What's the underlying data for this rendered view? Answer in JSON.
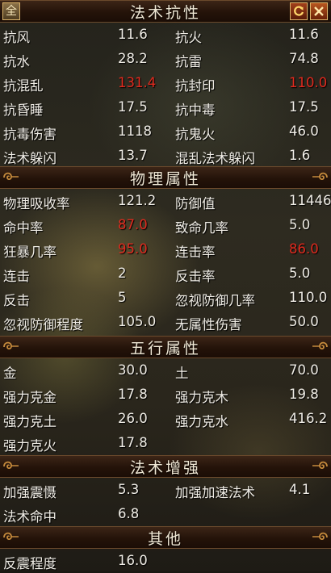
{
  "top_bar": {
    "all_button": "全",
    "refresh_icon": "refresh-icon",
    "close_icon": "close-icon"
  },
  "sections": {
    "spell_resist": {
      "title": "法术抗性",
      "rows": [
        {
          "k1": "抗风",
          "v1": "11.6",
          "k2": "抗火",
          "v2": "11.6"
        },
        {
          "k1": "抗水",
          "v1": "28.2",
          "k2": "抗雷",
          "v2": "74.8"
        },
        {
          "k1": "抗混乱",
          "v1": "131.4",
          "k2": "抗封印",
          "v2": "110.0"
        },
        {
          "k1": "抗昏睡",
          "v1": "17.5",
          "k2": "抗中毒",
          "v2": "17.5"
        },
        {
          "k1": "抗毒伤害",
          "v1": "1118",
          "k2": "抗鬼火",
          "v2": "46.0"
        },
        {
          "k1": "法术躲闪",
          "v1": "13.7",
          "k2": "混乱法术躲闪",
          "v2": "1.6"
        }
      ]
    },
    "physical": {
      "title": "物理属性",
      "rows": [
        {
          "k1": "物理吸收率",
          "v1": "121.2",
          "k2": "防御值",
          "v2": "11446"
        },
        {
          "k1": "命中率",
          "v1": "87.0",
          "k2": "致命几率",
          "v2": "5.0"
        },
        {
          "k1": "狂暴几率",
          "v1": "95.0",
          "k2": "连击率",
          "v2": "86.0"
        },
        {
          "k1": "连击",
          "v1": "2",
          "k2": "反击率",
          "v2": "5.0"
        },
        {
          "k1": "反击",
          "v1": "5",
          "k2": "忽视防御几率",
          "v2": "110.0"
        },
        {
          "k1": "忽视防御程度",
          "v1": "105.0",
          "k2": "无属性伤害",
          "v2": "50.0"
        }
      ]
    },
    "five_elements": {
      "title": "五行属性",
      "rows": [
        {
          "k1": "金",
          "v1": "30.0",
          "k2": "土",
          "v2": "70.0"
        },
        {
          "k1": "强力克金",
          "v1": "17.8",
          "k2": "强力克木",
          "v2": "19.8"
        },
        {
          "k1": "强力克土",
          "v1": "26.0",
          "k2": "强力克水",
          "v2": "416.2"
        },
        {
          "k1": "强力克火",
          "v1": "17.8"
        }
      ]
    },
    "spell_boost": {
      "title": "法术增强",
      "rows": [
        {
          "k1": "加强震慑",
          "v1": "5.3",
          "k2": "加强加速法术",
          "v2": "4.1"
        },
        {
          "k1": "法术命中",
          "v1": "6.8"
        }
      ]
    },
    "other": {
      "title": "其他",
      "rows": [
        {
          "k1": "反震程度",
          "v1": "16.0"
        }
      ]
    }
  },
  "colors": {
    "highlight_value": "#e02a1e",
    "normal_text": "#f0ede6",
    "header_bg": "#241309"
  }
}
